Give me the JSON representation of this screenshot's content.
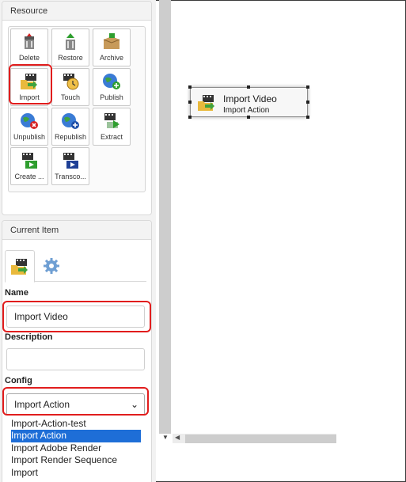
{
  "resource": {
    "title": "Resource",
    "tiles": [
      {
        "label": "Delete",
        "icon": "trash-film-icon"
      },
      {
        "label": "Restore",
        "icon": "restore-film-icon"
      },
      {
        "label": "Archive",
        "icon": "archive-box-icon"
      },
      {
        "label": "Import",
        "icon": "import-folder-icon"
      },
      {
        "label": "Touch",
        "icon": "touch-clock-icon"
      },
      {
        "label": "Publish",
        "icon": "publish-globe-icon"
      },
      {
        "label": "Unpublish",
        "icon": "unpublish-globe-icon"
      },
      {
        "label": "Republish",
        "icon": "republish-globe-icon"
      },
      {
        "label": "Extract",
        "icon": "extract-film-icon"
      },
      {
        "label": "Create ...",
        "icon": "create-film-icon"
      },
      {
        "label": "Transco...",
        "icon": "transcode-film-icon"
      }
    ]
  },
  "current_item": {
    "title": "Current Item",
    "tabs": [
      {
        "icon": "import-folder-icon",
        "active": true
      },
      {
        "icon": "gear-icon",
        "active": false
      }
    ],
    "name_label": "Name",
    "name_value": "Import Video",
    "description_label": "Description",
    "description_value": "",
    "config_label": "Config",
    "config_value": "Import Action",
    "config_options": [
      {
        "label": "Import-Action-test",
        "selected": false
      },
      {
        "label": "Import Action",
        "selected": true
      },
      {
        "label": "Import Adobe Render",
        "selected": false
      },
      {
        "label": "Import Render Sequence",
        "selected": false
      },
      {
        "label": "Import",
        "selected": false
      }
    ]
  },
  "canvas": {
    "node": {
      "title": "Import Video",
      "subtitle": "Import Action",
      "icon": "import-folder-icon"
    }
  },
  "colors": {
    "highlight": "#e11d1d",
    "selection": "#1e6ed7"
  }
}
